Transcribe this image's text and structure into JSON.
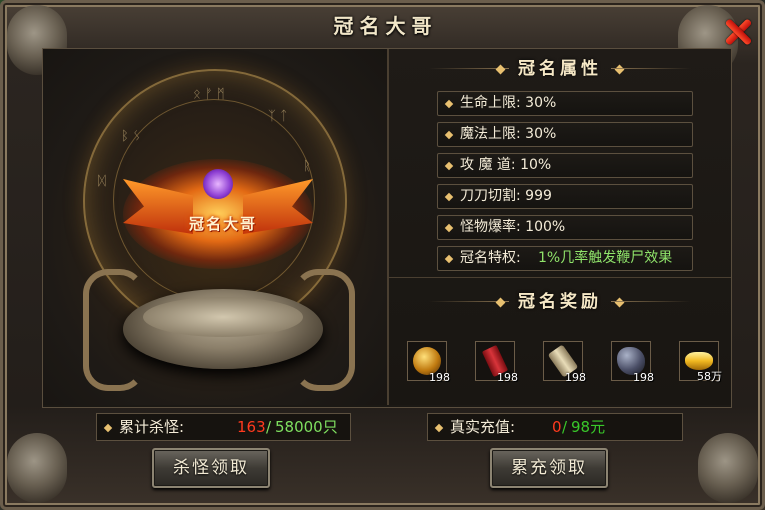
{
  "window": {
    "title": "冠名大哥"
  },
  "emblem": {
    "label": "冠名大哥"
  },
  "attributes": {
    "heading": "冠名属性",
    "items": [
      {
        "label": "生命上限: 30%"
      },
      {
        "label": "魔法上限: 30%"
      },
      {
        "label": "攻 魔 道: 10%"
      },
      {
        "label": "刀刀切割: 999"
      },
      {
        "label": "怪物爆率: 100%"
      },
      {
        "label": "冠名特权:",
        "value": "1%几率触发鞭尸效果"
      }
    ]
  },
  "rewards": {
    "heading": "冠名奖励",
    "items": [
      {
        "icon": "golden-orb-icon",
        "count": "198"
      },
      {
        "icon": "red-scroll-icon",
        "count": "198"
      },
      {
        "icon": "parchment-scroll-icon",
        "count": "198"
      },
      {
        "icon": "dark-stone-icon",
        "count": "198"
      },
      {
        "icon": "gold-ingot-icon",
        "count": "58万"
      }
    ]
  },
  "kills": {
    "label": "累计杀怪:",
    "current": "163",
    "separator": "/",
    "target": "58000只"
  },
  "recharge": {
    "label": "真实充值:",
    "current": "0",
    "separator": "/",
    "target": "98元"
  },
  "buttons": {
    "kill_claim": "杀怪领取",
    "recharge_claim": "累充领取"
  },
  "colors": {
    "accent_gold": "#e8c070",
    "value_red": "#ff3a1e",
    "value_green": "#7fe060",
    "privilege_green": "#8fe36a"
  }
}
